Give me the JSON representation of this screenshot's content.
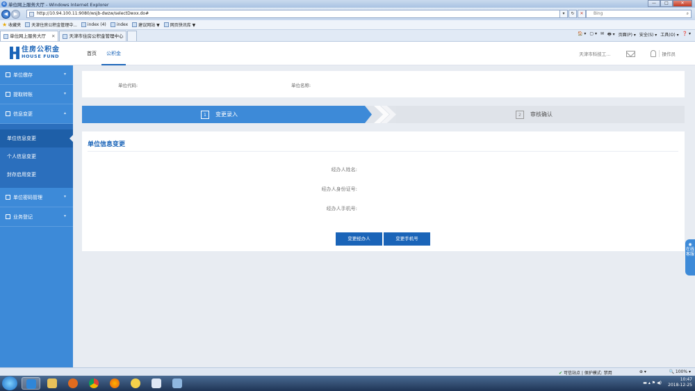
{
  "browser": {
    "window_title": "单位网上服务大厅 - Windows Internet Explorer",
    "window_buttons": [
      "—",
      "□",
      "✕"
    ],
    "url": "http://10.94.100.11:9080/wsjb-dwzw/selectDwxx.do#",
    "addr_buttons": [
      "▾",
      "↻",
      "✕"
    ],
    "search_placeholder": "Bing",
    "favorites_label": "收藏夹",
    "favorites": [
      "天津住房公积金管理中...",
      "index (4)",
      "index",
      "建议网站 ▼",
      "网页快讯库 ▼"
    ],
    "tabs": [
      {
        "label": "单位网上服务大厅",
        "close": "✕"
      },
      {
        "label": "天津市住房公积金管理中心",
        "close": ""
      }
    ],
    "tab_tools": [
      "🏠 ▾",
      "▢ ▾",
      "✉",
      "🖶 ▾",
      "页面(P) ▾",
      "安全(S) ▾",
      "工具(O) ▾",
      "❓ ▾"
    ],
    "status": {
      "zone": "可信站点 | 保护模式: 禁用",
      "zoom": "100%",
      "security": "⊕ ▾"
    }
  },
  "app": {
    "logo": {
      "cn": "住房公积金",
      "en": "HOUSE FUND"
    },
    "topnav": [
      "首页",
      "公积金"
    ],
    "header": {
      "company": "天津市科技工...",
      "operator": "操作员"
    },
    "sidebar": {
      "items": [
        {
          "label": "单位缴存",
          "chev": "▾"
        },
        {
          "label": "提取转账",
          "chev": "▾"
        },
        {
          "label": "信息变更",
          "chev": "▴"
        }
      ],
      "subitems": [
        "单位信息变更",
        "个人信息变更",
        "封存启用变更"
      ],
      "items_after": [
        {
          "label": "单位密码管理",
          "chev": "▾"
        },
        {
          "label": "业务登记",
          "chev": "▾"
        }
      ]
    },
    "info": {
      "unit_code_label": "单位代码:",
      "unit_name_label": "单位名称:"
    },
    "steps": [
      {
        "num": "1",
        "label": "变更录入"
      },
      {
        "num": "2",
        "label": "审核确认"
      }
    ],
    "form": {
      "section_title": "单位信息变更",
      "fields": [
        "经办人姓名:",
        "经办人身份证号:",
        "经办人手机号:"
      ],
      "buttons": [
        "变更经办人",
        "变更手机号"
      ]
    },
    "float_tab": "在线客服"
  },
  "taskbar": {
    "time": "10:47",
    "date": "2018-12-25"
  },
  "colors": {
    "sidebar": "#3d8ad8",
    "primary": "#1a64b8",
    "step_active": "#3d8ad8",
    "step_inactive": "#dfe3e9",
    "page_bg": "#e8ecf2"
  }
}
